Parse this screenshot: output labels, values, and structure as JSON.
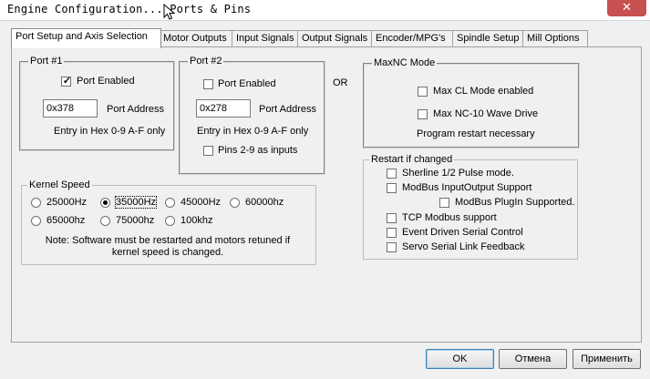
{
  "window": {
    "title": "Engine Configuration... Ports & Pins",
    "close_glyph": "✕"
  },
  "tabs": [
    {
      "label": "Port Setup and Axis Selection"
    },
    {
      "label": "Motor Outputs"
    },
    {
      "label": "Input Signals"
    },
    {
      "label": "Output Signals"
    },
    {
      "label": "Encoder/MPG's"
    },
    {
      "label": "Spindle Setup"
    },
    {
      "label": "Mill Options"
    }
  ],
  "active_tab": 0,
  "port1": {
    "legend": "Port #1",
    "enabled_label": "Port Enabled",
    "enabled_checked": true,
    "address_value": "0x378",
    "address_label": "Port Address",
    "hint": "Entry in Hex 0-9 A-F only"
  },
  "port2": {
    "legend": "Port #2",
    "enabled_label": "Port Enabled",
    "enabled_checked": false,
    "address_value": "0x278",
    "address_label": "Port Address",
    "hint": "Entry in Hex 0-9 A-F only",
    "pins_inputs_label": "Pins 2-9 as inputs",
    "pins_inputs_checked": false
  },
  "or_label": "OR",
  "maxnc": {
    "legend": "MaxNC Mode",
    "cl_mode_label": "Max CL Mode enabled",
    "cl_mode_checked": false,
    "wave_drive_label": "Max NC-10 Wave Drive",
    "wave_drive_checked": false,
    "note": "Program restart necessary"
  },
  "kernel": {
    "legend": "Kernel Speed",
    "options": [
      "25000Hz",
      "35000Hz",
      "45000Hz",
      "60000hz",
      "65000hz",
      "75000hz",
      "100khz"
    ],
    "selected": "35000Hz",
    "note_line1": "Note: Software must be restarted and motors retuned if",
    "note_line2": "kernel speed is changed."
  },
  "restart": {
    "legend": "Restart if changed",
    "items": [
      {
        "label": "Sherline 1/2 Pulse mode.",
        "checked": false
      },
      {
        "label": "ModBus InputOutput Support",
        "checked": false
      },
      {
        "label": "ModBus PlugIn Supported.",
        "checked": false
      },
      {
        "label": "TCP Modbus support",
        "checked": false
      },
      {
        "label": "Event Driven Serial Control",
        "checked": false
      },
      {
        "label": "Servo Serial Link Feedback",
        "checked": false
      }
    ]
  },
  "buttons": {
    "ok": "OK",
    "cancel": "Отмена",
    "apply": "Применить"
  }
}
